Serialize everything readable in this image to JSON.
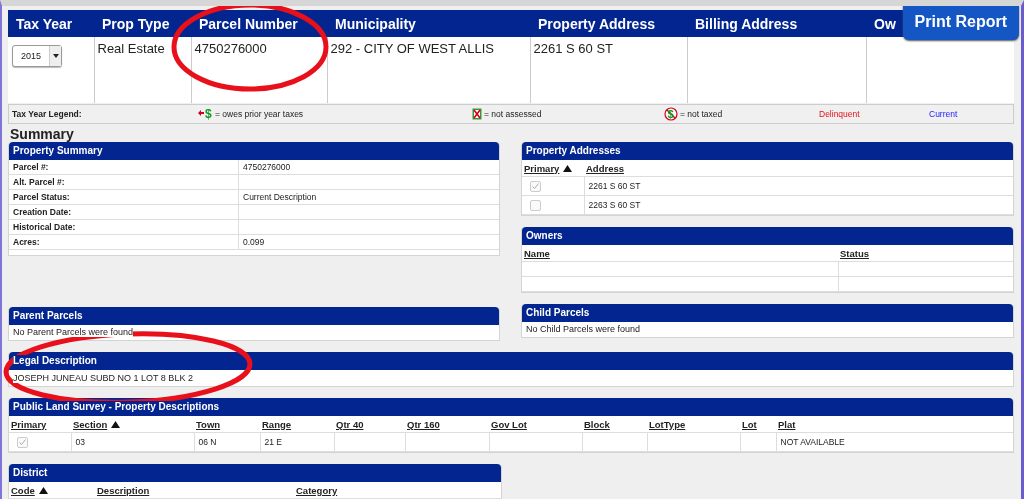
{
  "parcel_header": {
    "columns": [
      "Tax Year",
      "Prop Type",
      "Parcel Number",
      "Municipality",
      "Property Address",
      "Billing Address",
      "Ow"
    ],
    "tax_year": "2015",
    "prop_type": "Real Estate",
    "parcel_number": "4750276000",
    "municipality": "292 - CITY OF WEST ALLIS",
    "property_address": "2261 S 60 ST"
  },
  "print_button": "Print Report",
  "legend": {
    "label": "Tax Year Legend:",
    "items": [
      {
        "kind": "owes",
        "symbol": "$",
        "text": "= owes prior year taxes"
      },
      {
        "kind": "not_assessed",
        "text": "= not assessed"
      },
      {
        "kind": "not_taxed",
        "symbol": "$",
        "text": "= not taxed"
      },
      {
        "kind": "delinquent",
        "text": "Delinquent"
      },
      {
        "kind": "current",
        "text": "Current"
      }
    ]
  },
  "heading": "Summary",
  "property_summary": {
    "title": "Property Summary",
    "rows": [
      {
        "label": "Parcel #:",
        "value": "4750276000"
      },
      {
        "label": "Alt. Parcel #:"
      },
      {
        "label": "Parcel Status:",
        "value": "Current Description"
      },
      {
        "label": "Creation Date:"
      },
      {
        "label": "Historical Date:"
      },
      {
        "label": "Acres:",
        "value": "0.099"
      }
    ]
  },
  "property_addresses": {
    "title": "Property Addresses",
    "columns": [
      {
        "label": "Primary",
        "sorted": true
      },
      {
        "label": "Address",
        "sorted": false
      }
    ],
    "rows": [
      [
        {
          "kind": "checkbox",
          "checked": true
        },
        "2261 S 60 ST"
      ],
      [
        {
          "kind": "checkbox",
          "checked": false
        },
        "2263 S 60 ST"
      ]
    ]
  },
  "owners": {
    "title": "Owners",
    "columns": [
      {
        "label": "Name",
        "sorted": false
      },
      {
        "label": "Status",
        "sorted": false
      }
    ],
    "rows": [
      [
        null,
        null
      ],
      [
        null,
        null
      ]
    ]
  },
  "parent_parcels": {
    "title": "Parent Parcels",
    "message": "No Parent Parcels were found"
  },
  "child_parcels": {
    "title": "Child Parcels",
    "message": "No Child Parcels were found"
  },
  "legal_description": {
    "title": "Legal Description",
    "message": "JOSEPH JUNEAU SUBD NO 1 LOT 8 BLK 2"
  },
  "public_land_survey": {
    "title": "Public Land Survey - Property Descriptions",
    "columns": [
      {
        "label": "Primary",
        "sorted": false
      },
      {
        "label": "Section",
        "sorted": true
      },
      {
        "label": "Town",
        "sorted": false
      },
      {
        "label": "Range",
        "sorted": false
      },
      {
        "label": "Qtr 40",
        "sorted": false
      },
      {
        "label": "Qtr 160",
        "sorted": false
      },
      {
        "label": "Gov Lot",
        "sorted": false
      },
      {
        "label": "Block",
        "sorted": false
      },
      {
        "label": "LotType",
        "sorted": false
      },
      {
        "label": "Lot",
        "sorted": false
      },
      {
        "label": "Plat",
        "sorted": false
      }
    ],
    "rows": [
      [
        {
          "kind": "checkbox",
          "checked": true
        },
        "03",
        "06 N",
        "21 E",
        null,
        null,
        null,
        null,
        null,
        null,
        "NOT AVAILABLE"
      ]
    ]
  },
  "district": {
    "title": "District",
    "columns": [
      {
        "label": "Code",
        "sorted": true
      },
      {
        "label": "Description",
        "sorted": false
      },
      {
        "label": "Category",
        "sorted": false
      }
    ]
  },
  "annotations": [
    {
      "kind": "ellipse"
    },
    {
      "kind": "ellipse"
    }
  ]
}
